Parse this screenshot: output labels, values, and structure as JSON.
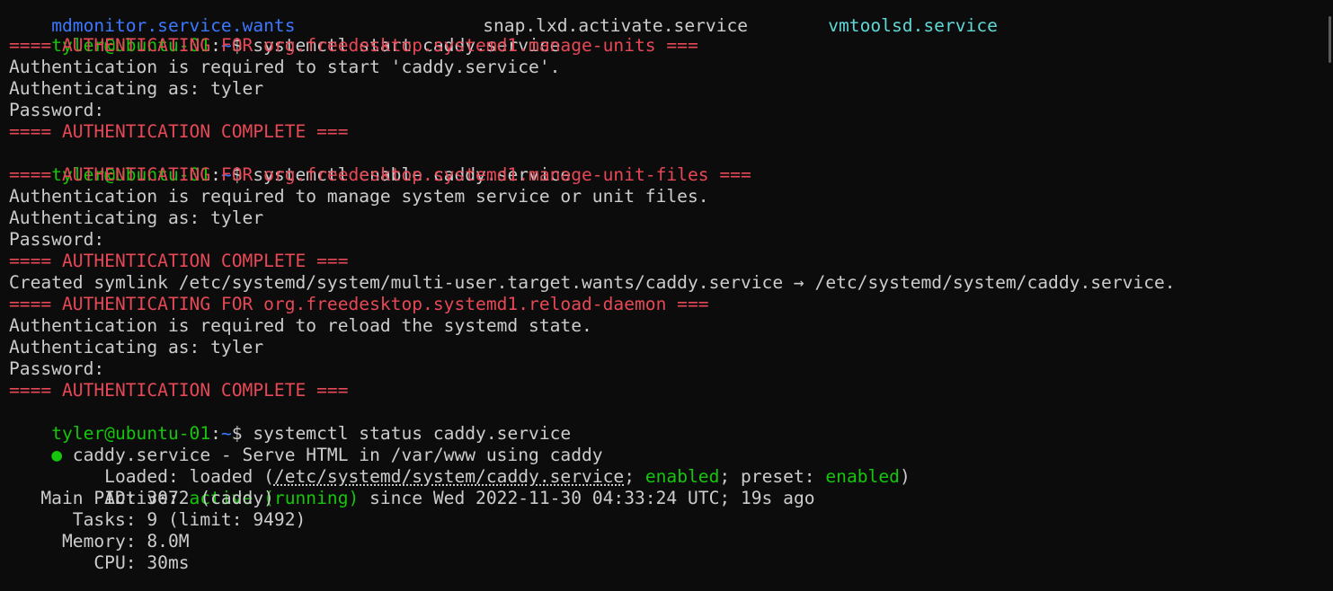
{
  "header_row": {
    "col1": "mdmonitor.service.wants",
    "col2": "snap.lxd.activate.service",
    "col3": "vmtoolsd.service"
  },
  "prompt": {
    "user_host": "tyler@ubuntu-01",
    "colon": ":",
    "path": "~",
    "dollar": "$ "
  },
  "commands": {
    "start": "systemctl start caddy.service",
    "enable": "systemctl enable caddy.service",
    "status": "systemctl status caddy.service"
  },
  "auth1": {
    "header": "==== AUTHENTICATING FOR org.freedesktop.systemd1.manage-units ===",
    "required": "Authentication is required to start 'caddy.service'.",
    "as": "Authenticating as: tyler",
    "password": "Password:",
    "complete": "==== AUTHENTICATION COMPLETE ==="
  },
  "auth2": {
    "header": "==== AUTHENTICATING FOR org.freedesktop.systemd1.manage-unit-files ===",
    "required": "Authentication is required to manage system service or unit files.",
    "as": "Authenticating as: tyler",
    "password": "Password:",
    "complete": "==== AUTHENTICATION COMPLETE ==="
  },
  "symlink": "Created symlink /etc/systemd/system/multi-user.target.wants/caddy.service → /etc/systemd/system/caddy.service.",
  "auth3": {
    "header": "==== AUTHENTICATING FOR org.freedesktop.systemd1.reload-daemon ===",
    "required": "Authentication is required to reload the systemd state.",
    "as": "Authenticating as: tyler",
    "password": "Password:",
    "complete": "==== AUTHENTICATION COMPLETE ==="
  },
  "status": {
    "bullet": "●",
    "title": " caddy.service - Serve HTML in /var/www using caddy",
    "loaded_label": "     Loaded: ",
    "loaded_pre": "loaded (",
    "loaded_path": "/etc/systemd/system/caddy.service",
    "loaded_sep1": "; ",
    "loaded_enabled": "enabled",
    "loaded_sep2": "; preset: ",
    "loaded_preset": "enabled",
    "loaded_post": ")",
    "active_label": "     Active: ",
    "active_state": "active (running)",
    "active_since": " since Wed 2022-11-30 04:33:24 UTC; 19s ago",
    "mainpid": "   Main PID: 3072 (caddy)",
    "tasks": "      Tasks: 9 (limit: 9492)",
    "memory": "     Memory: 8.0M",
    "cpu": "        CPU: 30ms"
  },
  "colors": {
    "background": "#0c0c0c",
    "text": "#cccccc",
    "red": "#e74856",
    "green": "#16c60c",
    "blue": "#3b78ff",
    "cyan": "#61d6d6"
  }
}
